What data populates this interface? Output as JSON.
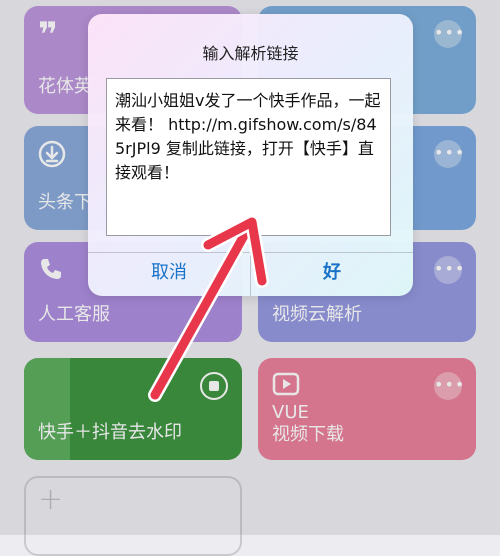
{
  "tiles": [
    {
      "label": "花体英"
    },
    {
      "label": "头条下"
    },
    {
      "label": "人工客服"
    },
    {
      "label": "视频云解析"
    },
    {
      "label": "快手＋抖音去水印"
    },
    {
      "line1": "VUE",
      "line2": "视频下载"
    }
  ],
  "add_tile": {
    "symbol": "+"
  },
  "more_glyph": "•••",
  "dialog": {
    "title": "输入解析链接",
    "text": "潮汕小姐姐v发了一个快手作品，一起来看！ http://m.gifshow.com/s/845rJPl9 复制此链接，打开【快手】直接观看！",
    "cancel_label": "取消",
    "ok_label": "好"
  },
  "colors": {
    "purple_tile": "#b07fd6",
    "blue_tile": "#6f9bd8",
    "violet_tile": "#9b83dd",
    "green_tile": "#2e8b2e",
    "pink_tile": "#e87391",
    "arrow": "#e8364a",
    "button_text": "#1a73c8"
  }
}
